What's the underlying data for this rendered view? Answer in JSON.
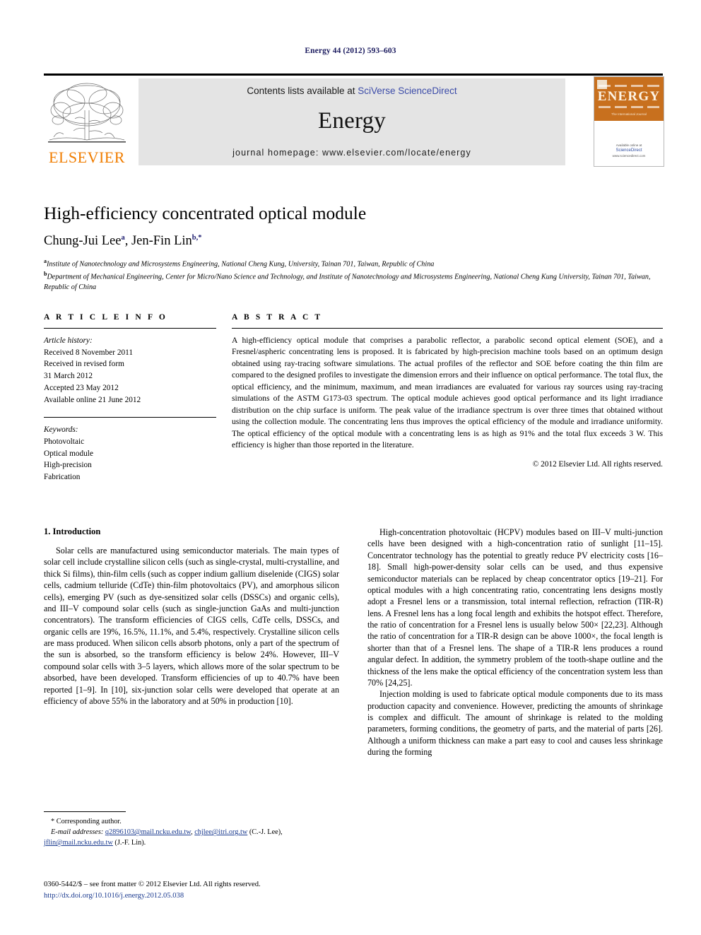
{
  "running_head": "Energy 44 (2012) 593–603",
  "masthead": {
    "contents_prefix": "Contents lists available at ",
    "sciencedirect": "SciVerse ScienceDirect",
    "journal_name": "Energy",
    "homepage": "journal homepage: www.elsevier.com/locate/energy",
    "publisher": "ELSEVIER",
    "publisher_logo_icon": "elsevier-tree-icon",
    "cover": {
      "title": "ENERGY",
      "subtitle": "The International Journal",
      "footer_prefix": "Available online at",
      "footer_brand": "ScienceDirect",
      "footer_url": "www.sciencedirect.com"
    },
    "accent_orange": "#f07d00",
    "link_blue": "#3b4ba8",
    "band_gray": "#e4e4e4"
  },
  "article": {
    "title": "High-efficiency concentrated optical module",
    "authors_plain": "Chung-Jui Lee a, Jen-Fin Lin b,*",
    "author1": "Chung-Jui Lee",
    "author1_sup": "a",
    "author_sep": ", ",
    "author2": "Jen-Fin Lin",
    "author2_sup": "b,*",
    "affiliation_a_sup": "a",
    "affiliation_a": "Institute of Nanotechnology and Microsystems Engineering, National Cheng Kung, University, Tainan 701, Taiwan, Republic of China",
    "affiliation_b_sup": "b",
    "affiliation_b": "Department of Mechanical Engineering, Center for Micro/Nano Science and Technology, and Institute of Nanotechnology and Microsystems Engineering, National Cheng Kung University, Tainan 701, Taiwan, Republic of China"
  },
  "article_info": {
    "label": "A R T I C L E  I N F O",
    "history_title": "Article history:",
    "history": [
      "Received 8 November 2011",
      "Received in revised form",
      "31 March 2012",
      "Accepted 23 May 2012",
      "Available online 21 June 2012"
    ],
    "keywords_title": "Keywords:",
    "keywords": [
      "Photovoltaic",
      "Optical module",
      "High-precision",
      "Fabrication"
    ]
  },
  "abstract": {
    "label": "A B S T R A C T",
    "text": "A high-efficiency optical module that comprises a parabolic reflector, a parabolic second optical element (SOE), and a Fresnel/aspheric concentrating lens is proposed. It is fabricated by high-precision machine tools based on an optimum design obtained using ray-tracing software simulations. The actual profiles of the reflector and SOE before coating the thin film are compared to the designed profiles to investigate the dimension errors and their influence on optical performance. The total flux, the optical efficiency, and the minimum, maximum, and mean irradiances are evaluated for various ray sources using ray-tracing simulations of the ASTM G173-03 spectrum. The optical module achieves good optical performance and its light irradiance distribution on the chip surface is uniform. The peak value of the irradiance spectrum is over three times that obtained without using the collection module. The concentrating lens thus improves the optical efficiency of the module and irradiance uniformity. The optical efficiency of the optical module with a concentrating lens is as high as 91% and the total flux exceeds 3 W. This efficiency is higher than those reported in the literature.",
    "copyright": "© 2012 Elsevier Ltd. All rights reserved."
  },
  "body": {
    "section_heading": "1. Introduction",
    "left_paragraphs": [
      "Solar cells are manufactured using semiconductor materials. The main types of solar cell include crystalline silicon cells (such as single-crystal, multi-crystalline, and thick Si films), thin-film cells (such as copper indium gallium diselenide (CIGS) solar cells, cadmium telluride (CdTe) thin-film photovoltaics (PV), and amorphous silicon cells), emerging PV (such as dye-sensitized solar cells (DSSCs) and organic cells), and III–V compound solar cells (such as single-junction GaAs and multi-junction concentrators). The transform efficiencies of CIGS cells, CdTe cells, DSSCs, and organic cells are 19%, 16.5%, 11.1%, and 5.4%, respectively. Crystalline silicon cells are mass produced. When silicon cells absorb photons, only a part of the spectrum of the sun is absorbed, so the transform efficiency is below 24%. However, III–V compound solar cells with 3–5 layers, which allows more of the solar spectrum to be absorbed, have been developed. Transform efficiencies of up to 40.7% have been reported [1–9]. In [10], six-junction solar cells were developed that operate at an efficiency of above 55% in the laboratory and at 50% in production [10]."
    ],
    "right_paragraphs": [
      "High-concentration photovoltaic (HCPV) modules based on III–V multi-junction cells have been designed with a high-concentration ratio of sunlight [11–15]. Concentrator technology has the potential to greatly reduce PV electricity costs [16–18]. Small high-power-density solar cells can be used, and thus expensive semiconductor materials can be replaced by cheap concentrator optics [19–21]. For optical modules with a high concentrating ratio, concentrating lens designs mostly adopt a Fresnel lens or a transmission, total internal reflection, refraction (TIR-R) lens. A Fresnel lens has a long focal length and exhibits the hotspot effect. Therefore, the ratio of concentration for a Fresnel lens is usually below 500× [22,23]. Although the ratio of concentration for a TIR-R design can be above 1000×, the focal length is shorter than that of a Fresnel lens. The shape of a TIR-R lens produces a round angular defect. In addition, the symmetry problem of the tooth-shape outline and the thickness of the lens make the optical efficiency of the concentration system less than 70% [24,25].",
      "Injection molding is used to fabricate optical module components due to its mass production capacity and convenience. However, predicting the amounts of shrinkage is complex and difficult. The amount of shrinkage is related to the molding parameters, forming conditions, the geometry of parts, and the material of parts [26]. Although a uniform thickness can make a part easy to cool and causes less shrinkage during the forming"
    ]
  },
  "footnote": {
    "corresponding": "* Corresponding author.",
    "email_label": "E-mail addresses:",
    "email1": "q2896103@mail.ncku.edu.tw",
    "email_comma": ", ",
    "email2": "chjlee@itri.org.tw",
    "email_author1": " (C.-J. Lee), ",
    "email3": "jflin@mail.ncku.edu.tw",
    "email_author2": " (J.-F. Lin)."
  },
  "bottom": {
    "issn_line": "0360-5442/$ – see front matter © 2012 Elsevier Ltd. All rights reserved.",
    "doi_line": "http://dx.doi.org/10.1016/j.energy.2012.05.038"
  }
}
